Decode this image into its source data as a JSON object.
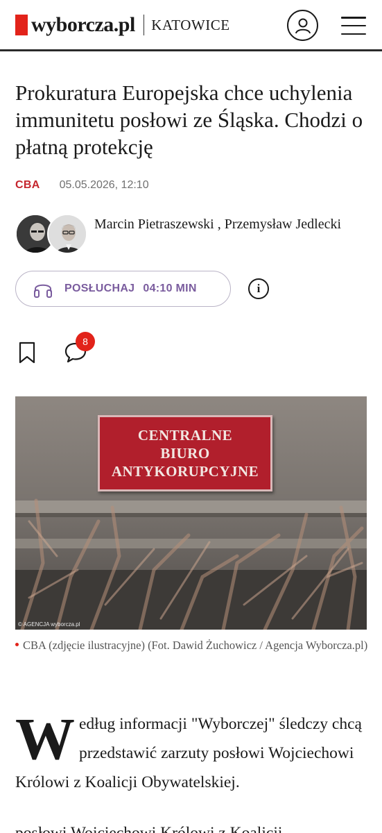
{
  "header": {
    "logo_text": "wyborcza.pl",
    "section": "KATOWICE",
    "brand_color": "#e2231a"
  },
  "article": {
    "headline": "Prokuratura Europejska chce uchylenia immunitetu posłowi ze Śląska. Chodzi o płatną protekcję",
    "category": "CBA",
    "date": "05.05.2026, 12:10",
    "authors": "Marcin Pietraszewski , Przemysław Jedlecki",
    "listen_label": "POSŁUCHAJ",
    "listen_duration": "04:10 MIN",
    "comment_count": "8",
    "photo": {
      "sign_lines": [
        "CENTRALNE",
        "BIURO",
        "ANTYKORUPCYJNE"
      ],
      "credit": "© AGENCJA wyborcza.pl"
    },
    "caption": "CBA (zdjęcie ilustracyjne) (Fot. Dawid Żuchowicz / Agencja Wyborcza.pl)",
    "body_dropcap": "W",
    "body_text": "edług informacji \"Wyborczej\" śledczy chcą przedstawić zarzuty posłowi Wojciechowi Królowi z Koalicji Obywatelskiej.",
    "body_next_line": "posłowi Wojciechowi Królowi z Koalicji"
  },
  "icons": {
    "user": "user-icon",
    "menu": "hamburger-menu-icon",
    "headphones": "headphones-icon",
    "info": "info-icon",
    "bookmark": "bookmark-icon",
    "comment": "comment-icon"
  },
  "colors": {
    "category": "#c5262e",
    "listen": "#7a5c9e",
    "badge": "#e2231a"
  }
}
